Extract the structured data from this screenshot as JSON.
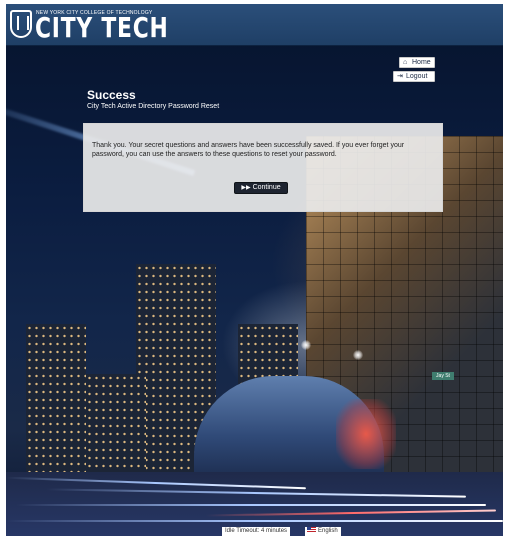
{
  "header": {
    "college_line": "NEW YORK CITY COLLEGE OF TECHNOLOGY",
    "brand": "CITY TECH"
  },
  "nav": {
    "home_label": "Home",
    "logout_label": "Logout"
  },
  "page": {
    "title": "Success",
    "subtitle": "City Tech Active Directory Password Reset"
  },
  "panel": {
    "message": "Thank you. Your secret questions and answers have been successfully saved. If you ever forget your password, you can use the answers to these questions to reset your password.",
    "continue_label": "Continue"
  },
  "scene": {
    "street_sign": "Jay St"
  },
  "footer": {
    "timeout": "Idle Timeout: 4 minutes",
    "language": "English"
  },
  "colors": {
    "header_bar": "#2b4f7a",
    "panel_bg": "#eaeaea",
    "button_dark": "#1e2430"
  },
  "icons": {
    "home": "home-icon",
    "logout": "logout-icon",
    "continue": "fast-forward-icon",
    "flag": "us-flag-icon"
  }
}
